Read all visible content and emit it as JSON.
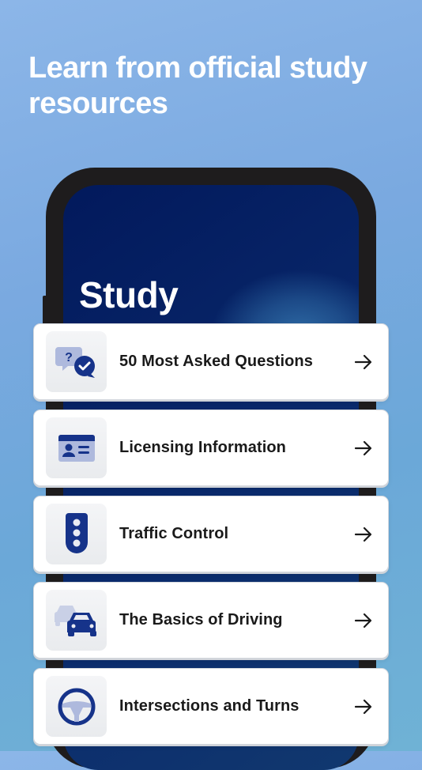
{
  "headline": "Learn from official study resources",
  "screen": {
    "title": "Study"
  },
  "colors": {
    "brand_navy": "#16338a",
    "brand_light": "#aeb9dd"
  },
  "study_items": [
    {
      "label": "50 Most Asked Questions",
      "icon": "question-chat-icon"
    },
    {
      "label": "Licensing Information",
      "icon": "id-card-icon"
    },
    {
      "label": "Traffic Control",
      "icon": "traffic-light-icon"
    },
    {
      "label": "The Basics of Driving",
      "icon": "cars-icon"
    },
    {
      "label": "Intersections and Turns",
      "icon": "steering-wheel-icon"
    }
  ]
}
